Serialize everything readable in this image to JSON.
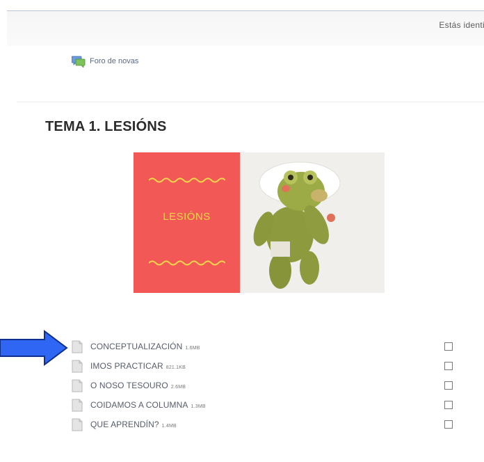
{
  "header": {
    "login_text": "Estás identi"
  },
  "forum": {
    "label": "Foro de novas",
    "icon": "forum-chat-icon"
  },
  "section": {
    "title": "TEMA 1. LESIÓNS",
    "banner_word": "LESIÓNS",
    "colors": {
      "banner_red": "#f25956",
      "banner_text": "#f3d64a",
      "arrow_fill": "#3066f4"
    }
  },
  "resources": [
    {
      "name": "CONCEPTUALIZACIÓN",
      "size": "1.6MB",
      "icon": "file-icon",
      "completed": false
    },
    {
      "name": "IMOS PRACTICAR",
      "size": "821.1KB",
      "icon": "file-icon",
      "completed": false
    },
    {
      "name": "O NOSO TESOURO",
      "size": "2.6MB",
      "icon": "file-icon",
      "completed": false
    },
    {
      "name": "COIDAMOS A COLUMNA",
      "size": "1.3MB",
      "icon": "file-icon",
      "completed": false
    },
    {
      "name": "QUE APRENDÍN?",
      "size": "1.4MB",
      "icon": "file-icon",
      "completed": false
    }
  ]
}
